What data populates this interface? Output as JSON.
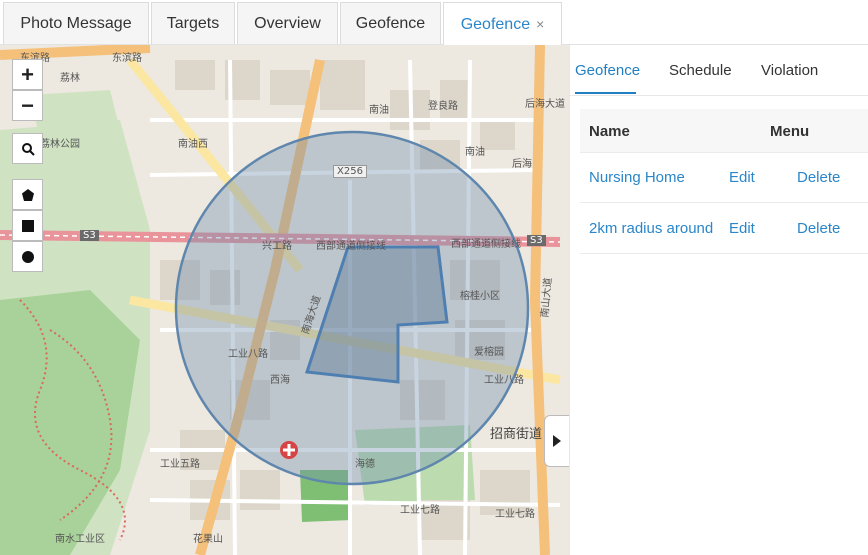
{
  "tabs": [
    {
      "label": "Photo Message"
    },
    {
      "label": "Targets"
    },
    {
      "label": "Overview"
    },
    {
      "label": "Geofence"
    },
    {
      "label": "Geofence",
      "close": "×"
    }
  ],
  "map": {
    "zoom_in": "+",
    "zoom_out": "−",
    "labels": [
      "东滨路",
      "东滨路",
      "荔林",
      "南油西",
      "南油",
      "南油",
      "后海",
      "后海大道",
      "兴工路",
      "西部通道侧接线",
      "西部通道侧接线",
      "S3",
      "S3",
      "X256",
      "南海大道",
      "榕桂小区",
      "工业八路",
      "工业八路",
      "爱榕园",
      "西海",
      "招商街道",
      "南水工业区",
      "花果山",
      "工业七路",
      "工业七路",
      "南山大道",
      "荔林公园",
      "登良路",
      "海德",
      "工业五路"
    ]
  },
  "panel": {
    "tabs": [
      {
        "label": "Geofence"
      },
      {
        "label": "Schedule"
      },
      {
        "label": "Violation"
      }
    ],
    "table": {
      "headers": {
        "name": "Name",
        "menu": "Menu"
      },
      "rows": [
        {
          "name": "Nursing Home",
          "edit": "Edit",
          "delete": "Delete"
        },
        {
          "name": "2km radius around",
          "edit": "Edit",
          "delete": "Delete"
        }
      ]
    }
  },
  "colors": {
    "accent": "#1f7fc1",
    "geofence_fill": "#6f8fae",
    "geofence_stroke": "#5f87ad"
  }
}
